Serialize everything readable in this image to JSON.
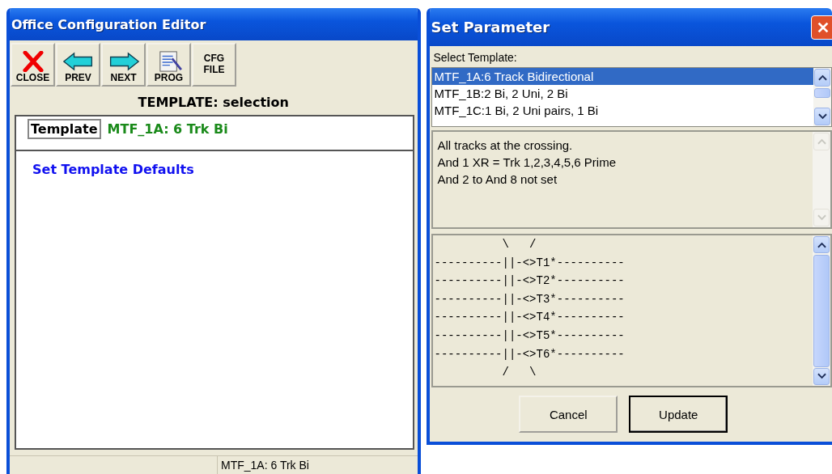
{
  "editor_window": {
    "title": "Office Configuration Editor",
    "toolbar": [
      {
        "kind": "close",
        "label": "CLOSE"
      },
      {
        "kind": "prev",
        "label": "PREV"
      },
      {
        "kind": "next",
        "label": "NEXT"
      },
      {
        "kind": "prog",
        "label": "PROG"
      },
      {
        "kind": "text",
        "label": "CFG FILE"
      }
    ],
    "heading": "TEMPLATE:  selection",
    "template_field": {
      "label": "Template",
      "value": "MTF_1A: 6 Trk Bi"
    },
    "link": "Set Template Defaults",
    "status_bar": [
      "MTF_1A: 6 Trk Bi"
    ]
  },
  "dialog": {
    "title": "Set Parameter",
    "list_label": "Select Template:",
    "templates": [
      {
        "label": "MTF_1A:6 Track Bidirectional",
        "selected": true
      },
      {
        "label": "MTF_1B:2 Bi, 2 Uni, 2 Bi",
        "selected": false
      },
      {
        "label": "MTF_1C:1 Bi, 2 Uni pairs, 1 Bi",
        "selected": false
      }
    ],
    "description": [
      "All tracks at the crossing.",
      "And 1 XR = Trk 1,2,3,4,5,6 Prime",
      "And 2 to And 8 not set"
    ],
    "diagram": [
      "          \\   /",
      "----------||-<>T1*----------",
      "----------||-<>T2*----------",
      "----------||-<>T3*----------",
      "----------||-<>T4*----------",
      "----------||-<>T5*----------",
      "----------||-<>T6*----------",
      "          /   \\"
    ],
    "buttons": [
      {
        "label": "Cancel",
        "default": false
      },
      {
        "label": "Update",
        "default": true
      }
    ]
  }
}
